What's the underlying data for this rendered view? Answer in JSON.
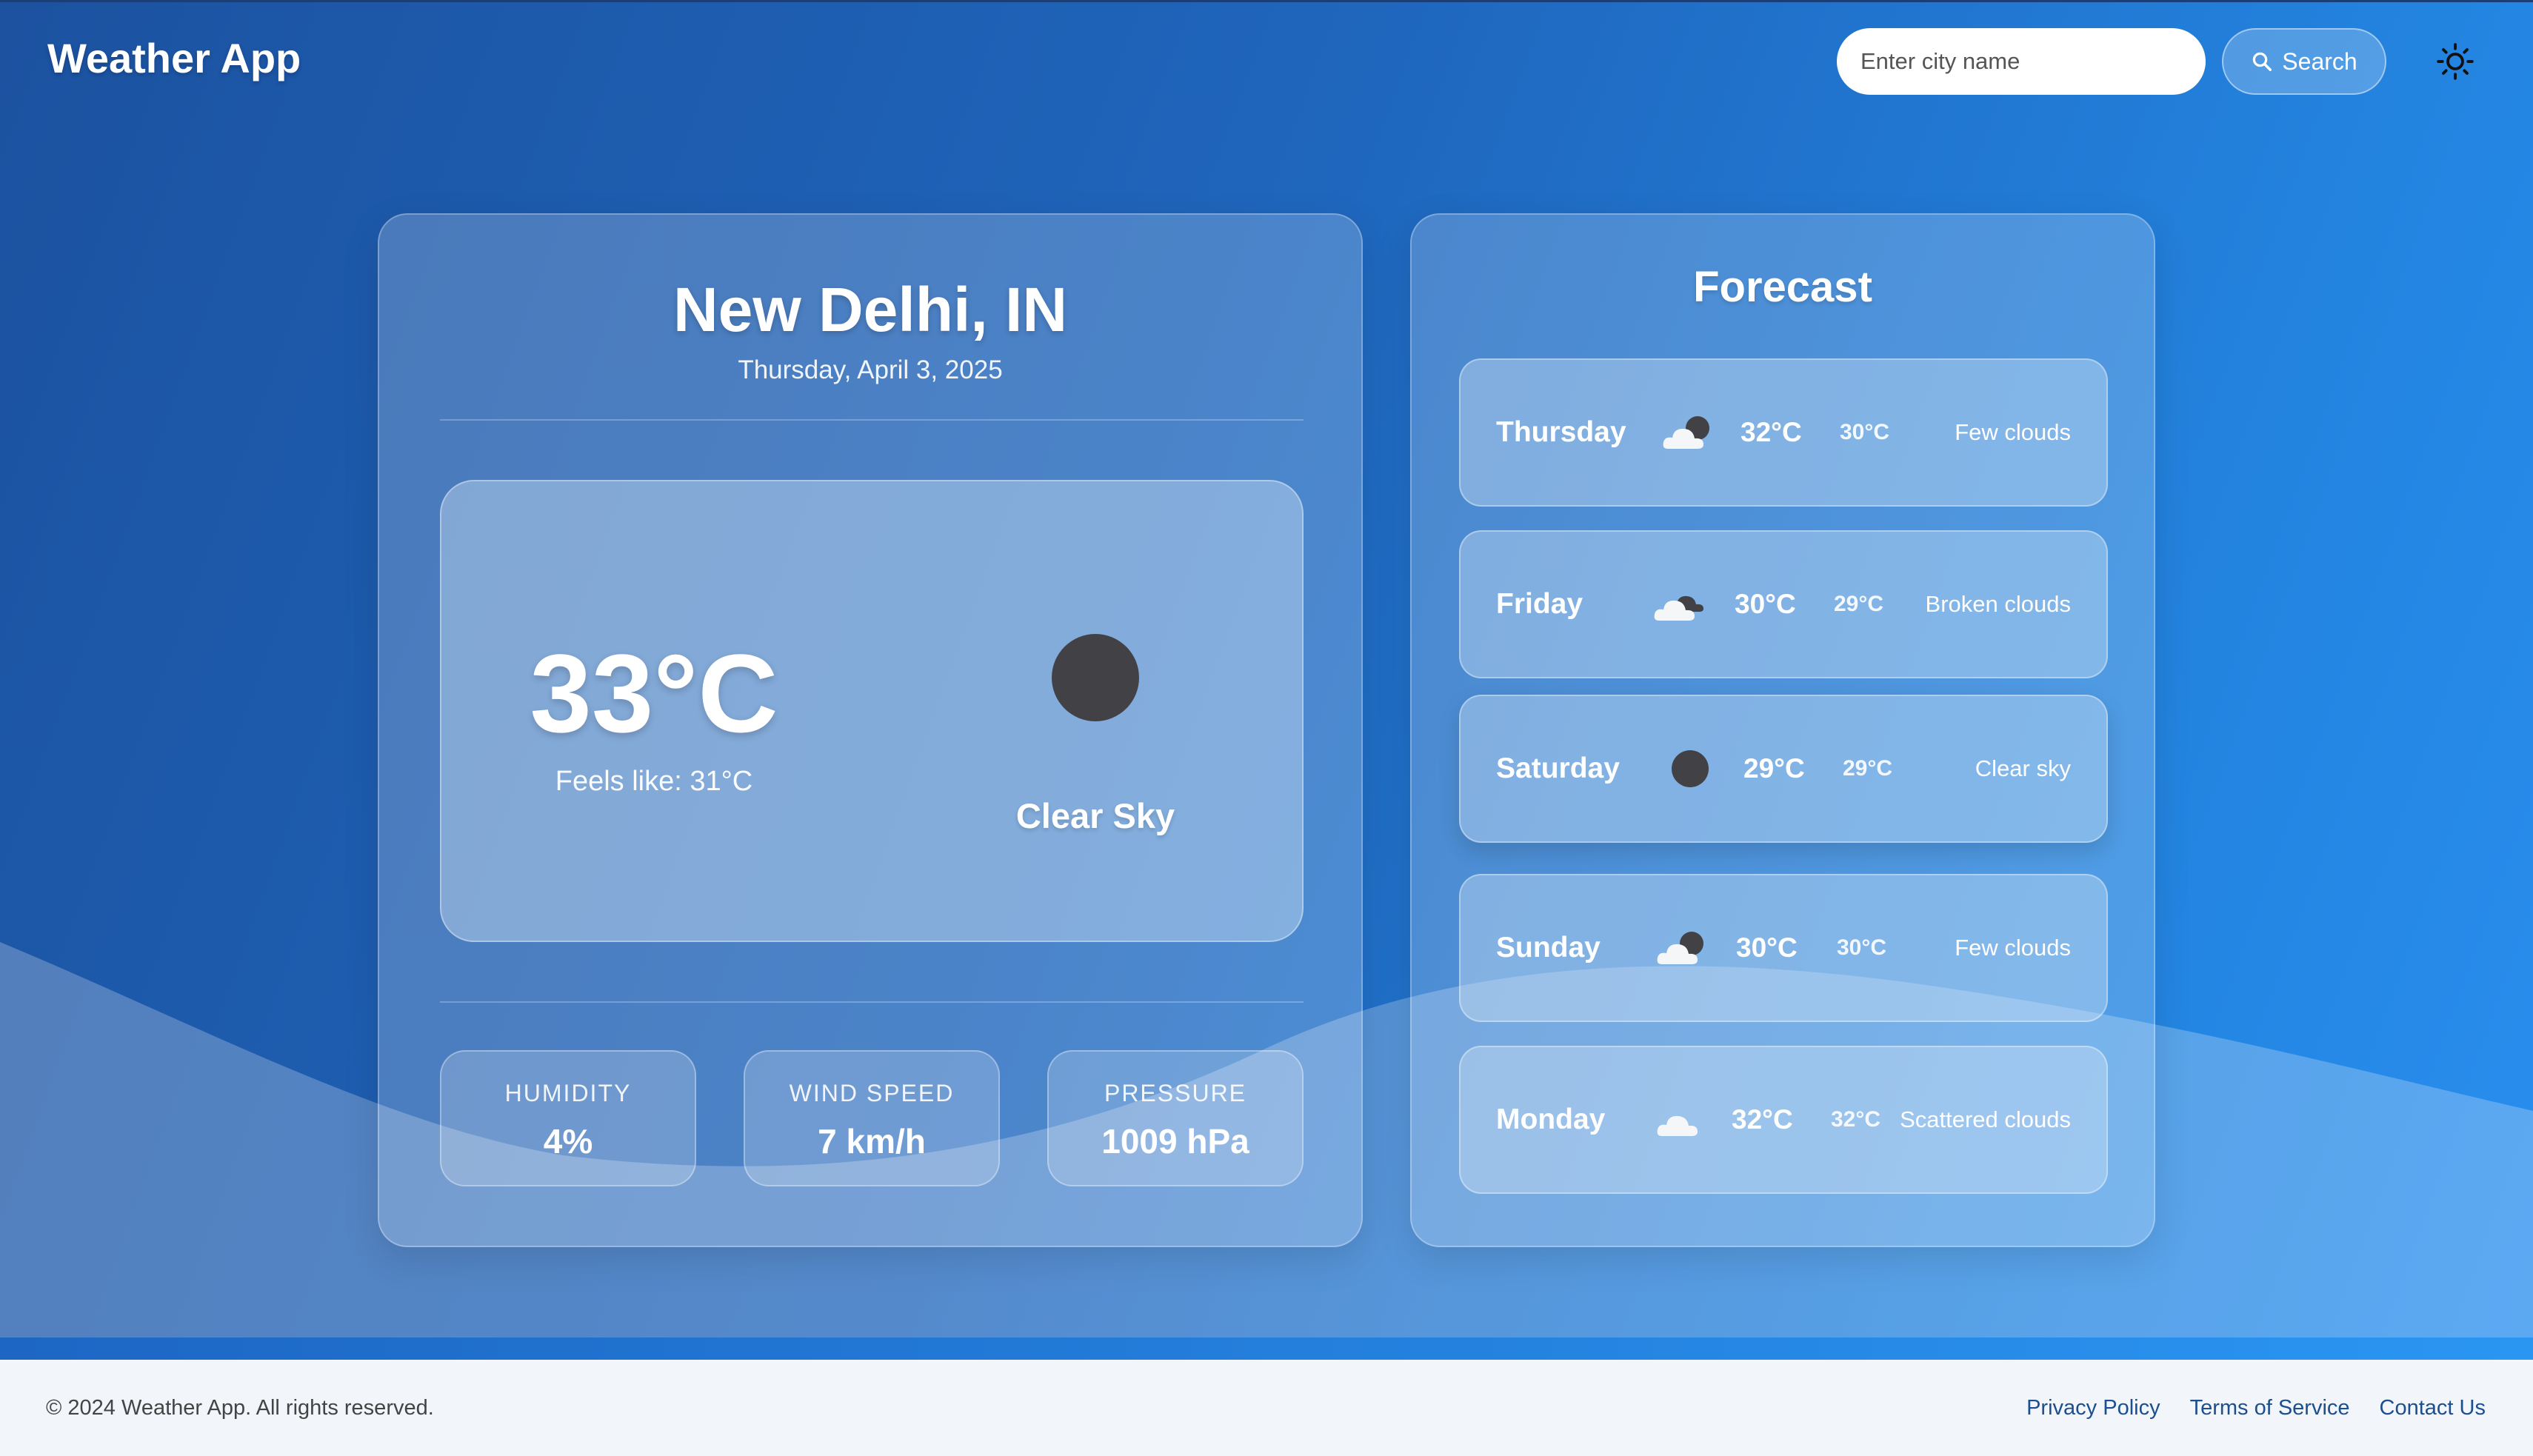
{
  "header": {
    "app_title": "Weather App",
    "search_placeholder": "Enter city name",
    "search_label": "Search",
    "theme_icon": "sun-icon"
  },
  "current": {
    "city": "New Delhi, IN",
    "date": "Thursday, April 3, 2025",
    "temperature": "33°C",
    "feels_like": "Feels like: 31°C",
    "condition": "Clear Sky",
    "icon": "clear-sky-icon",
    "stats": [
      {
        "label": "HUMIDITY",
        "value": "4%"
      },
      {
        "label": "WIND SPEED",
        "value": "7 km/h"
      },
      {
        "label": "PRESSURE",
        "value": "1009 hPa"
      }
    ]
  },
  "forecast": {
    "title": "Forecast",
    "days": [
      {
        "day": "Thursday",
        "icon": "few-clouds-icon",
        "max": "32°C",
        "min": "30°C",
        "desc": "Few clouds"
      },
      {
        "day": "Friday",
        "icon": "broken-clouds-icon",
        "max": "30°C",
        "min": "29°C",
        "desc": "Broken clouds"
      },
      {
        "day": "Saturday",
        "icon": "clear-sky-icon",
        "max": "29°C",
        "min": "29°C",
        "desc": "Clear sky"
      },
      {
        "day": "Sunday",
        "icon": "few-clouds-icon",
        "max": "30°C",
        "min": "30°C",
        "desc": "Few clouds"
      },
      {
        "day": "Monday",
        "icon": "scattered-clouds-icon",
        "max": "32°C",
        "min": "32°C",
        "desc": "Scattered clouds"
      }
    ]
  },
  "footer": {
    "copyright": "© 2024 Weather App. All rights reserved.",
    "links": [
      "Privacy Policy",
      "Terms of Service",
      "Contact Us"
    ]
  },
  "colors": {
    "background_start": "#1c52a0",
    "background_end": "#2a8ff0",
    "sun_disc": "#424246",
    "footer_bg": "#f2f6fb",
    "footer_link": "#1b4f8f"
  }
}
